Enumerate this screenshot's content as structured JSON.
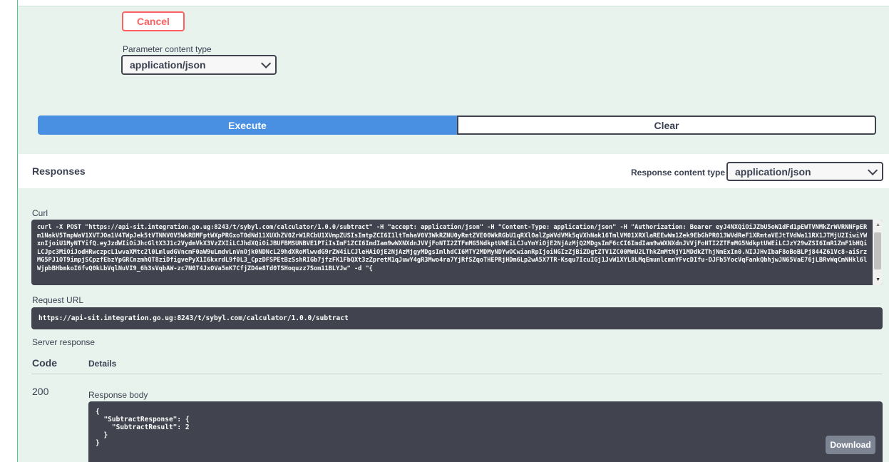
{
  "parameters": {
    "cancel_label": "Cancel",
    "content_type_label": "Parameter content type",
    "content_type_value": "application/json",
    "execute_label": "Execute",
    "clear_label": "Clear"
  },
  "responses": {
    "title": "Responses",
    "content_type_label": "Response content type",
    "content_type_value": "application/json"
  },
  "curl": {
    "label": "Curl",
    "text": "curl -X POST \"https://api-sit.integration.go.ug:8243/t/sybyl.com/calculator/1.0.0/subtract\" -H \"accept: application/json\" -H \"Content-Type: application/json\" -H \"Authorization: Bearer eyJ4NXQiOiJZbU5oW1dFd1pEWTVNMkZrWVRNNFpERm1NakV5TmpWaV1XVTJOa1V4TWpJek5tVTNNV0V5WkRBMFptWXpPRGxoT0dNd11XUXhZV0ZrW1RCbU1XVmpZUSIsImtpZCI6I1ltTmhaV0V3WkRZNU0yRmtZVE00WkRGbU1qRXlOalZpWVdVMk5qVXhNak16TmlVM01XRXlaREEwWm1Zek9EbGhPR013WVdReF1XRmtaVEJtTVdWa11RX1JTMjU2IiwiYWxnIjoiU1MyNTYifQ.eyJzdWIiOiJhcGltX3J1c2VydmVkX3VzZXIiLCJhdXQiOiJBUFBMSUNBVE1PTiIsImF1ZCI6ImdIam9wWXNXdnJVVjFoNTI2ZTFmMG5NdkptUWEiLCJuYmYiOjE2NjAzMjQ2MDgsImF6cCI6ImdIam9wWXNXdnJVVjFoNTI2ZTFmMG5NdkptUWEiLCJzY29wZSI6ImR1ZmF1bHQiLCJpc3MiOiJodHRwczpcL1wvaXMtc2l0LmludGVncmF0aW9uLmdvLnVnOjk0NDNcL29hdXRoMlwvdG9rZW4iLCJleHAiOjE2NjAzMjgyMDgsImlhdCI6MTY2MDMyNDYwOCwianRpIjoiNGIzZjBiZDgtZTV1ZC00MmU2LThkZmMtNjY1MDdkZThjNmExIn0.NIJJHvIbaF8oBoBLPj844Z61Vc8-aiSrzMG5PJ1OT9impjSCpzfEbzYpGRCnzmhQT8ziDfigvePyX1I6kxrdL9f0L3_CpzDFSPEtBzSshRIGb7jfzFK1FbQXt3zZpretM1qJuwY4gR3Mwo4ra7YjRfSZqoTHEPRjHDm6Lp2wA5X7TR-Ksqu7IcuIGj1JvW1XYL8LMqEmunlcmnYFvcDIfu-DJFb5YocVqFankQbhjwJN65VaE76jLBRvWqCmNHkl6lWjpbBHbmkoI6fvQ0kLbVqlNuVI9_6h3sVqbAW-zc7N0T4JxOVa5nK7CfjZD4e8Td0TSHoquzz7Som11BLYJw\" -d \"{"
  },
  "request_url": {
    "label": "Request URL",
    "value": "https://api-sit.integration.go.ug:8243/t/sybyl.com/calculator/1.0.0/subtract"
  },
  "server_response": {
    "label": "Server response",
    "code_header": "Code",
    "details_header": "Details",
    "code": "200",
    "body_label": "Response body",
    "body": "{\n  \"SubtractResponse\": {\n    \"SubtractResult\": 2\n  }\n}",
    "download_label": "Download"
  }
}
